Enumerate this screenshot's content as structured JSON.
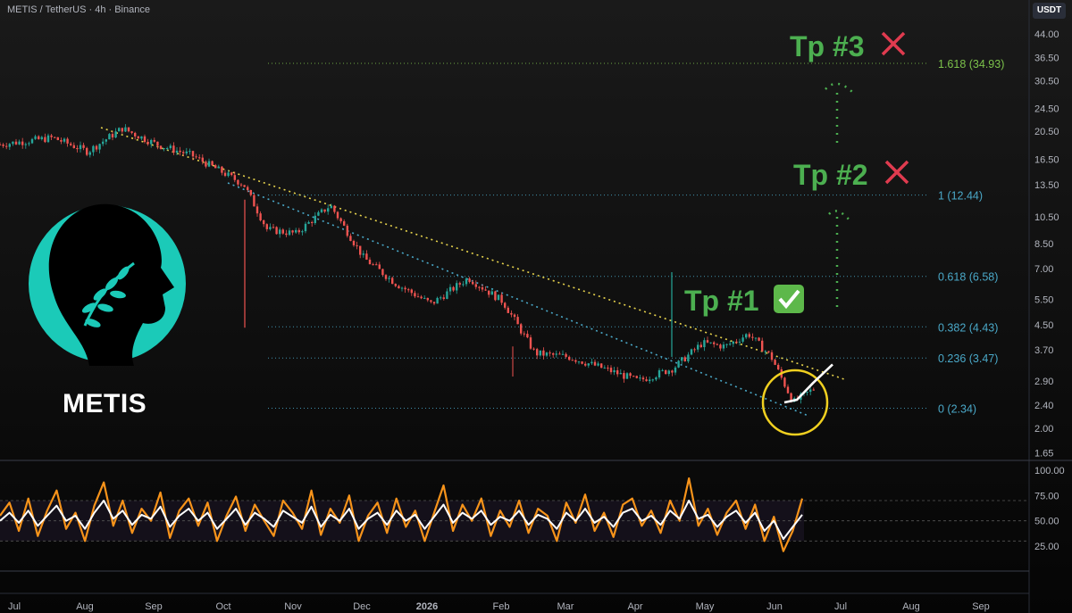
{
  "header": {
    "symbol": "METIS / TetherUS · 4h · Binance",
    "currency": "USDT"
  },
  "logo": {
    "name": "METIS",
    "color": "#1bcab8"
  },
  "colors": {
    "up": "#26a69a",
    "down": "#ef5350",
    "fib": "#4aa8c8",
    "fib_top": "#7cc24b",
    "tp_green": "#4caf50",
    "cross_red": "#e03b4f",
    "trendline_yellow": "#e8d44d",
    "trendline_blue": "#4aa8c8",
    "circle": "#f0d020",
    "rsi_orange": "#f7931a",
    "rsi_white": "#ffffff"
  },
  "targets": [
    {
      "label": "Tp #1",
      "status": "✅"
    },
    {
      "label": "Tp #2",
      "status": "✕"
    },
    {
      "label": "Tp #3",
      "status": "✕"
    }
  ],
  "chart_data": [
    {
      "type": "line",
      "title": "",
      "price_axis": {
        "scale": "log",
        "ticks": [
          "44.00",
          "36.50",
          "30.50",
          "24.50",
          "20.50",
          "16.50",
          "13.50",
          "10.50",
          "8.50",
          "7.00",
          "5.50",
          "4.50",
          "3.70",
          "2.90",
          "2.40",
          "2.00",
          "1.65"
        ],
        "tick_values": [
          44.0,
          36.5,
          30.5,
          24.5,
          20.5,
          16.5,
          13.5,
          10.5,
          8.5,
          7.0,
          5.5,
          4.5,
          3.7,
          2.9,
          2.4,
          2.0,
          1.65
        ]
      },
      "time_axis": [
        "Jul",
        "Aug",
        "Sep",
        "Oct",
        "Nov",
        "Dec",
        "2026",
        "Feb",
        "Mar",
        "Apr",
        "May",
        "Jun",
        "Jul",
        "Aug",
        "Sep"
      ],
      "fib_levels": [
        {
          "ratio": "1.618",
          "value": 34.93,
          "label": "1.618 (34.93)"
        },
        {
          "ratio": "1",
          "value": 12.44,
          "label": "1 (12.44)"
        },
        {
          "ratio": "0.618",
          "value": 6.58,
          "label": "0.618 (6.58)"
        },
        {
          "ratio": "0.382",
          "value": 4.43,
          "label": "0.382 (4.43)"
        },
        {
          "ratio": "0.236",
          "value": 3.47,
          "label": "0.236 (3.47)"
        },
        {
          "ratio": "0",
          "value": 2.34,
          "label": "0 (2.34)"
        }
      ],
      "price_path": [
        [
          "Jul",
          18.5
        ],
        [
          "Jul",
          19.5
        ],
        [
          "Aug",
          17.5
        ],
        [
          "Aug",
          21.0
        ],
        [
          "Sep",
          18.5
        ],
        [
          "Sep",
          17.0
        ],
        [
          "Oct",
          15.0
        ],
        [
          "Oct",
          13.5
        ],
        [
          "Oct",
          9.5
        ],
        [
          "Nov",
          9.2
        ],
        [
          "Nov",
          11.5
        ],
        [
          "Dec",
          7.6
        ],
        [
          "Dec",
          6.2
        ],
        [
          "2026",
          5.3
        ],
        [
          "2026",
          6.5
        ],
        [
          "Feb",
          5.4
        ],
        [
          "Feb",
          3.6
        ],
        [
          "Mar",
          3.5
        ],
        [
          "Mar",
          3.2
        ],
        [
          "Apr",
          2.9
        ],
        [
          "Apr",
          3.2
        ],
        [
          "May",
          3.9
        ],
        [
          "May",
          3.8
        ],
        [
          "May",
          4.2
        ],
        [
          "Jun",
          3.5
        ],
        [
          "Jun",
          2.45
        ],
        [
          "Jun",
          2.75
        ]
      ],
      "projection_path": [
        2.45,
        2.5,
        2.85,
        3.3
      ]
    },
    {
      "type": "line",
      "title": "",
      "y_ticks": [
        "100.00",
        "75.00",
        "50.00",
        "25.00"
      ],
      "ylim": [
        0,
        100
      ],
      "band": [
        30,
        70
      ],
      "series": [
        {
          "values": [
            55,
            68,
            40,
            72,
            35,
            60,
            80,
            42,
            58,
            30,
            65,
            88,
            45,
            70,
            38,
            62,
            50,
            78,
            33,
            60,
            72,
            45,
            68,
            30,
            55,
            74,
            40,
            66,
            50,
            35,
            70,
            58,
            42,
            80,
            36,
            62,
            48,
            75,
            30,
            55,
            68,
            38,
            72,
            44,
            60,
            30,
            58,
            85,
            40,
            66,
            50,
            72,
            35,
            60,
            44,
            70,
            38,
            62,
            55,
            30,
            68,
            48,
            76,
            40,
            58,
            34,
            66,
            72,
            45,
            60,
            38,
            70,
            50,
            92,
            45,
            62,
            36,
            58,
            70,
            42,
            66,
            30,
            54,
            20,
            40,
            72
          ]
        },
        {
          "values": [
            50,
            58,
            48,
            60,
            45,
            55,
            65,
            50,
            55,
            42,
            58,
            70,
            52,
            60,
            46,
            56,
            52,
            64,
            44,
            55,
            62,
            50,
            58,
            42,
            52,
            62,
            46,
            58,
            52,
            44,
            60,
            54,
            48,
            64,
            44,
            56,
            50,
            62,
            42,
            52,
            58,
            46,
            60,
            50,
            56,
            42,
            54,
            66,
            48,
            58,
            52,
            60,
            46,
            54,
            50,
            60,
            46,
            56,
            52,
            42,
            58,
            50,
            62,
            48,
            54,
            44,
            58,
            62,
            50,
            55,
            46,
            60,
            52,
            70,
            52,
            56,
            44,
            54,
            60,
            48,
            58,
            40,
            50,
            32,
            44,
            56
          ]
        }
      ]
    }
  ]
}
